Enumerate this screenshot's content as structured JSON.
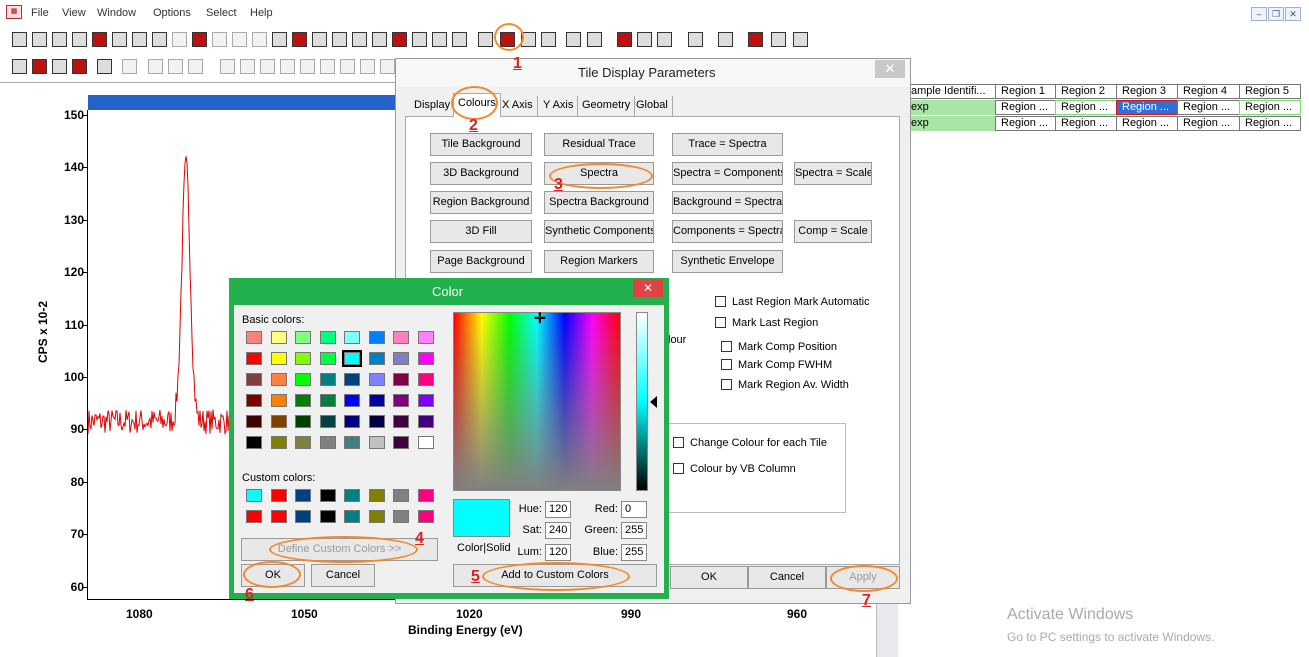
{
  "menu": {
    "items": [
      "File",
      "View",
      "Window",
      "Options",
      "Select",
      "Help"
    ]
  },
  "plot": {
    "y_ticks": [
      "150",
      "140",
      "130",
      "120",
      "110",
      "100",
      "90",
      "80",
      "70",
      "60"
    ],
    "x_ticks": [
      "1080",
      "1050",
      "1020",
      "990",
      "960"
    ],
    "xlabel": "Binding Energy (eV)",
    "ylabel": "CPS x 10-2"
  },
  "grid": {
    "headers": [
      "ample Identifi...",
      "Region 1",
      "Region 2",
      "Region 3",
      "Region 4",
      "Region 5"
    ],
    "rows": [
      [
        "exp",
        "Region ...",
        "Region ...",
        "Region ...",
        "Region ...",
        "Region ..."
      ],
      [
        "exp",
        "Region ...",
        "Region ...",
        "Region ...",
        "Region ...",
        "Region ..."
      ]
    ]
  },
  "tile_dialog": {
    "title": "Tile Display Parameters",
    "tabs": [
      "Display",
      "Colours",
      "X Axis",
      "Y Axis",
      "Geometry",
      "Global"
    ],
    "buttons": {
      "tile_background": "Tile Background",
      "residual_trace": "Residual Trace",
      "trace_spectra": "Trace = Spectra",
      "bg_3d": "3D Background",
      "spectra": "Spectra",
      "spectra_components": "Spectra = Components",
      "spectra_scale": "Spectra = Scale",
      "region_background": "Region Background",
      "spectra_background": "Spectra Background",
      "background_spectra": "Background = Spectra",
      "fill_3d": "3D Fill",
      "synthetic_components": "Synthetic Components",
      "components_spectra": "Components = Spectra",
      "comp_scale": "Comp = Scale",
      "page_background": "Page Background",
      "region_markers": "Region Markers",
      "synthetic_envelope": "Synthetic Envelope",
      "ok": "OK",
      "cancel": "Cancel",
      "apply": "Apply"
    },
    "checks": {
      "last_region_mark_automatic": "Last Region Mark Automatic",
      "mark_last_region": "Mark Last Region",
      "mark_comp_position": "Mark Comp Position",
      "mark_comp_fwhm": "Mark Comp FWHM",
      "mark_region_av_width": "Mark Region Av. Width",
      "change_colour_each_tile": "Change Colour for each Tile",
      "colour_by_vb_column": "Colour by VB Column"
    },
    "partial_label": "lour"
  },
  "color_dialog": {
    "title": "Color",
    "basic_colors_label": "Basic colors:",
    "custom_colors_label": "Custom colors:",
    "define_custom": "Define Custom Colors >>",
    "ok": "OK",
    "cancel": "Cancel",
    "add_custom": "Add to Custom Colors",
    "color_solid_label": "Color|Solid",
    "hue_label": "Hue:",
    "hue": "120",
    "sat_label": "Sat:",
    "sat": "240",
    "lum_label": "Lum:",
    "lum": "120",
    "red_label": "Red:",
    "red": "0",
    "green_label": "Green:",
    "green": "255",
    "blue_label": "Blue:",
    "blue": "255",
    "selected_color": "#00ffff",
    "basic_colors": [
      [
        "#ff8080",
        "#ffff80",
        "#80ff80",
        "#00ff80",
        "#80ffff",
        "#0080ff",
        "#ff80c0",
        "#ff80ff"
      ],
      [
        "#ff0000",
        "#ffff00",
        "#80ff00",
        "#00ff40",
        "#00ffff",
        "#0080c0",
        "#8080c0",
        "#ff00ff"
      ],
      [
        "#804040",
        "#ff8040",
        "#00ff00",
        "#008080",
        "#004080",
        "#8080ff",
        "#800040",
        "#ff0080"
      ],
      [
        "#800000",
        "#ff8000",
        "#008000",
        "#008040",
        "#0000ff",
        "#0000a0",
        "#800080",
        "#8000ff"
      ],
      [
        "#400000",
        "#804000",
        "#004000",
        "#004040",
        "#000080",
        "#000040",
        "#400040",
        "#400080"
      ],
      [
        "#000000",
        "#808000",
        "#808040",
        "#808080",
        "#408080",
        "#c0c0c0",
        "#400040",
        "#ffffff"
      ]
    ],
    "custom_colors": [
      [
        "#00ffff",
        "#ff0000",
        "#004080",
        "#000000",
        "#008080",
        "#808000",
        "#808080",
        "#ff0080"
      ],
      [
        "#ff0000",
        "#ff0000",
        "#004080",
        "#000000",
        "#008080",
        "#808000",
        "#808080",
        "#ff0080"
      ]
    ]
  },
  "annotations": [
    "1",
    "2",
    "3",
    "4",
    "5",
    "6",
    "7"
  ],
  "watermark": {
    "line1": "Activate Windows",
    "line2": "Go to PC settings to activate Windows."
  },
  "colors": {
    "accent_green": "#1fb04b",
    "annotation_orange": "#f28a2c",
    "annotation_red": "#d22222",
    "trace_red": "#e00000"
  }
}
